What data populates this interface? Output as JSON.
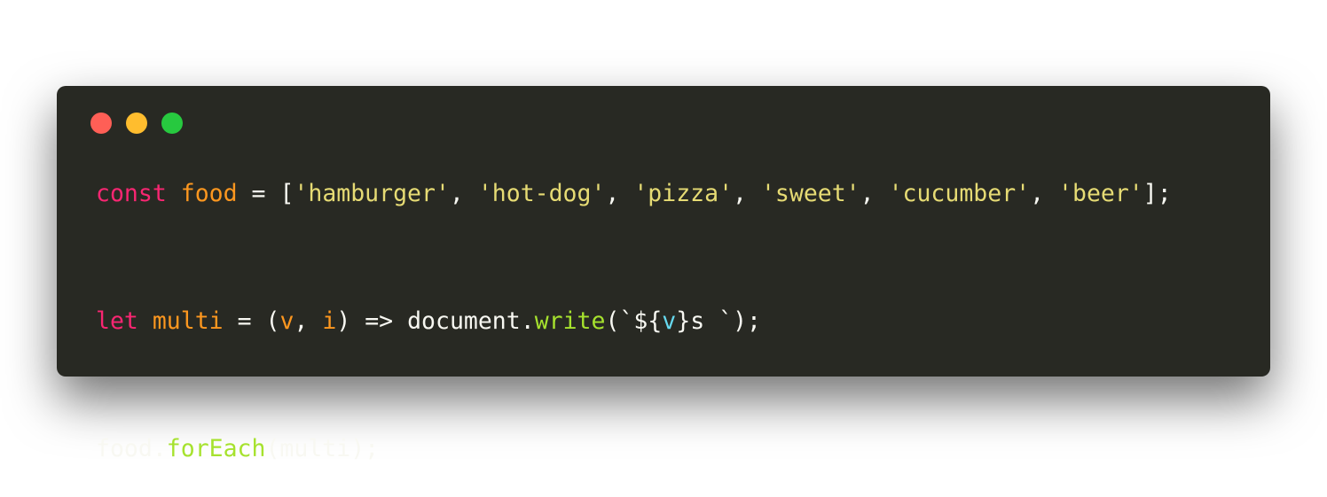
{
  "window": {
    "buttons": [
      {
        "name": "close",
        "color": "#ff5f56"
      },
      {
        "name": "minimize",
        "color": "#ffbd2e"
      },
      {
        "name": "maximize",
        "color": "#27c93f"
      }
    ],
    "background": "#282923"
  },
  "code": {
    "lines": [
      {
        "tokens": [
          {
            "t": "const",
            "c": "kw"
          },
          {
            "t": " ",
            "c": "plain"
          },
          {
            "t": "food",
            "c": "var"
          },
          {
            "t": " = [",
            "c": "plain"
          },
          {
            "t": "'hamburger'",
            "c": "str"
          },
          {
            "t": ", ",
            "c": "plain"
          },
          {
            "t": "'hot-dog'",
            "c": "str"
          },
          {
            "t": ", ",
            "c": "plain"
          },
          {
            "t": "'pizza'",
            "c": "str"
          },
          {
            "t": ", ",
            "c": "plain"
          },
          {
            "t": "'sweet'",
            "c": "str"
          },
          {
            "t": ", ",
            "c": "plain"
          },
          {
            "t": "'cucumber'",
            "c": "str"
          },
          {
            "t": ", ",
            "c": "plain"
          },
          {
            "t": "'beer'",
            "c": "str"
          },
          {
            "t": "];",
            "c": "plain"
          }
        ]
      },
      {
        "tokens": [
          {
            "t": "let",
            "c": "kw"
          },
          {
            "t": " ",
            "c": "plain"
          },
          {
            "t": "multi",
            "c": "var"
          },
          {
            "t": " = (",
            "c": "plain"
          },
          {
            "t": "v",
            "c": "var"
          },
          {
            "t": ", ",
            "c": "plain"
          },
          {
            "t": "i",
            "c": "var"
          },
          {
            "t": ") => document.",
            "c": "plain"
          },
          {
            "t": "write",
            "c": "fn"
          },
          {
            "t": "(`${",
            "c": "plain"
          },
          {
            "t": "v",
            "c": "tmpl"
          },
          {
            "t": "}s `);",
            "c": "plain"
          }
        ]
      },
      {
        "tokens": [
          {
            "t": "food.",
            "c": "plain"
          },
          {
            "t": "forEach",
            "c": "fn"
          },
          {
            "t": "(multi);",
            "c": "plain"
          }
        ]
      }
    ]
  },
  "colors": {
    "keyword": "#f92672",
    "variable": "#fd971f",
    "string": "#e6db74",
    "function": "#a6e22e",
    "template_var": "#66d9ef",
    "plain": "#f8f8f2"
  }
}
